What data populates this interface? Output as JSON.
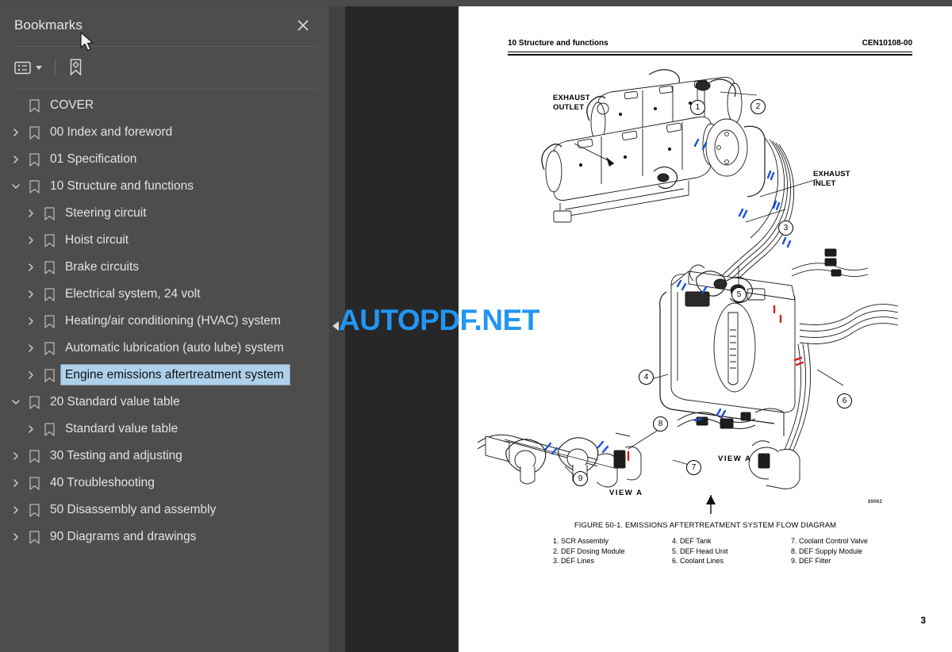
{
  "sidebar": {
    "title": "Bookmarks",
    "close_icon": "close-icon",
    "toolbar": {
      "options_icon": "list-options-icon",
      "caret_icon": "chevron-down-icon",
      "bookmark_settings_icon": "bookmark-settings-icon"
    },
    "items": [
      {
        "label": "COVER",
        "depth": 0,
        "chevron": "none"
      },
      {
        "label": "00 Index and foreword",
        "depth": 0,
        "chevron": "right"
      },
      {
        "label": "01 Specification",
        "depth": 0,
        "chevron": "right"
      },
      {
        "label": "10 Structure and functions",
        "depth": 0,
        "chevron": "down"
      },
      {
        "label": "Steering circuit",
        "depth": 1,
        "chevron": "right"
      },
      {
        "label": "Hoist circuit",
        "depth": 1,
        "chevron": "right"
      },
      {
        "label": "Brake circuits",
        "depth": 1,
        "chevron": "right"
      },
      {
        "label": "Electrical system, 24 volt",
        "depth": 1,
        "chevron": "right"
      },
      {
        "label": "Heating/air conditioning (HVAC) system",
        "depth": 1,
        "chevron": "right"
      },
      {
        "label": "Automatic lubrication (auto lube) system",
        "depth": 1,
        "chevron": "right"
      },
      {
        "label": "Engine emissions aftertreatment system",
        "depth": 1,
        "chevron": "right",
        "selected": true
      },
      {
        "label": "20 Standard value table",
        "depth": 0,
        "chevron": "down"
      },
      {
        "label": "Standard value table",
        "depth": 1,
        "chevron": "right"
      },
      {
        "label": "30 Testing and adjusting",
        "depth": 0,
        "chevron": "right"
      },
      {
        "label": "40 Troubleshooting",
        "depth": 0,
        "chevron": "right"
      },
      {
        "label": "50 Disassembly and assembly",
        "depth": 0,
        "chevron": "right"
      },
      {
        "label": "90 Diagrams and drawings",
        "depth": 0,
        "chevron": "right"
      }
    ]
  },
  "watermark": {
    "text": "AUTOPDF.NET",
    "color": "#2196f3"
  },
  "page": {
    "header_left": "10 Structure and functions",
    "header_right": "CEN10108-00",
    "page_number": "3",
    "drawing_number": "89062",
    "caption": "FIGURE 50-1. EMISSIONS AFTERTREATMENT SYSTEM FLOW DIAGRAM",
    "figure_labels": {
      "exhaust_outlet": "EXHAUST\nOUTLET",
      "exhaust_outlet_line1": "EXHAUST",
      "exhaust_outlet_line2": "OUTLET",
      "exhaust_inlet_line1": "EXHAUST",
      "exhaust_inlet_line2": "INLET",
      "view_a_1": "VIEW A",
      "view_a_2": "VIEW A"
    },
    "callouts": [
      "1",
      "2",
      "3",
      "4",
      "5",
      "6",
      "7",
      "8",
      "9"
    ],
    "legend": {
      "col1": [
        "1. SCR Assembly",
        "2. DEF Dosing Module",
        "3. DEF Lines"
      ],
      "col2": [
        "4. DEF Tank",
        "5. DEF Head Unit",
        "6. Coolant Lines"
      ],
      "col3": [
        "7. Coolant Control Valve",
        "8. DEF Supply Module",
        "9. DEF Filter"
      ]
    }
  }
}
